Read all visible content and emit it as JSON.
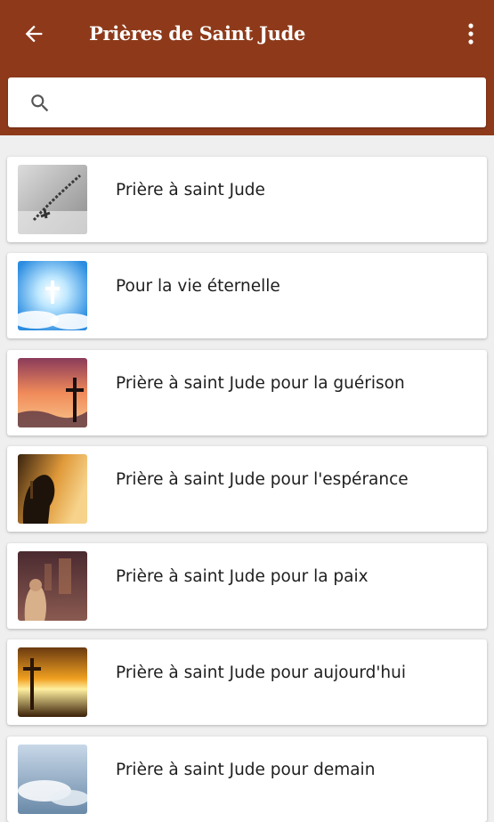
{
  "header": {
    "title": "Prières de Saint Jude",
    "back_icon": "arrow-left-icon",
    "menu_icon": "more-vertical-icon",
    "background_color": "#8e3a1a"
  },
  "search": {
    "value": "",
    "placeholder": "",
    "icon": "search-icon"
  },
  "prayers": [
    {
      "label": "Prière à saint Jude",
      "thumbnail": "rosary-on-book"
    },
    {
      "label": "Pour la vie éternelle",
      "thumbnail": "cross-in-bright-sky"
    },
    {
      "label": "Prière à saint Jude pour la guérison",
      "thumbnail": "cross-at-sunset"
    },
    {
      "label": "Prière à saint Jude pour l'espérance",
      "thumbnail": "praying-woman"
    },
    {
      "label": "Prière à saint Jude pour la paix",
      "thumbnail": "church-interior"
    },
    {
      "label": "Prière à saint Jude pour aujourd'hui",
      "thumbnail": "golden-cross-sky"
    },
    {
      "label": "Prière à saint Jude pour demain",
      "thumbnail": "clouds-sky"
    }
  ]
}
